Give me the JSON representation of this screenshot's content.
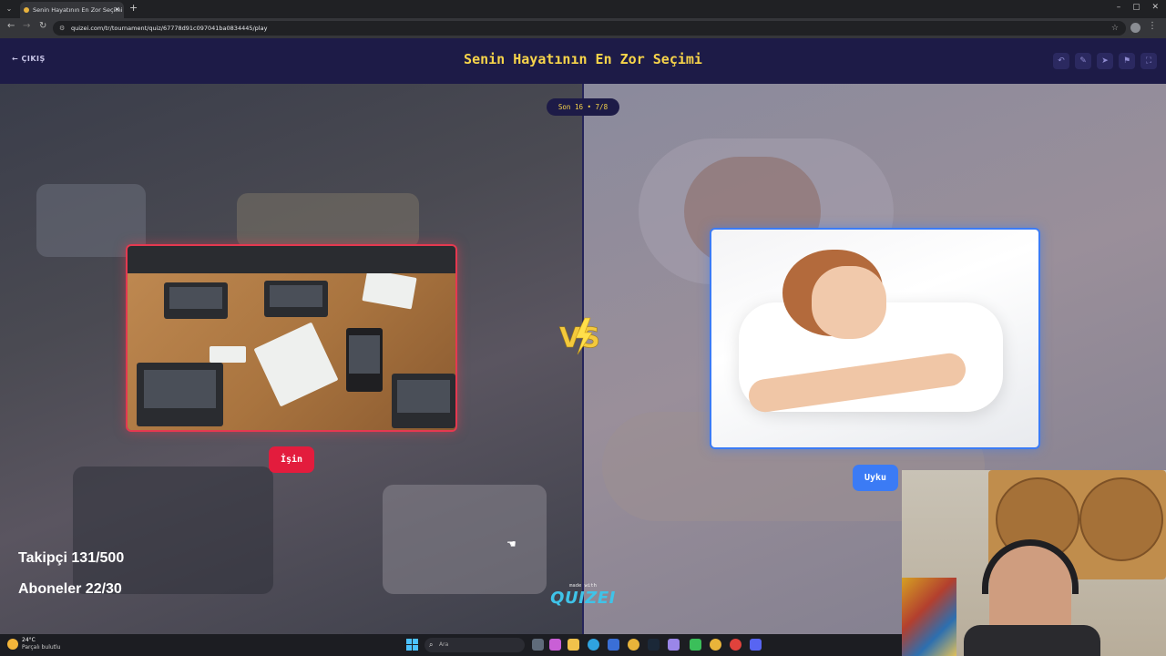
{
  "browser": {
    "tab_title": "Senin Hayatının En Zor Seçimi -",
    "url": "quizei.com/tr/tournament/quiz/67778d91c097041ba0834445/play"
  },
  "header": {
    "exit_label": "ÇIKIŞ",
    "title": "Senin Hayatının En Zor Seçimi"
  },
  "round": {
    "label": "Son 16 • 7/8"
  },
  "choices": {
    "left_label": "İşin",
    "right_label": "Uyku"
  },
  "stats": {
    "followers": "Takipçi 131/500",
    "subscribers": "Aboneler 22/30"
  },
  "branding": {
    "made_with": "made with",
    "logo": "QUIZEI"
  },
  "taskbar": {
    "temperature": "24°C",
    "weather": "Parçalı bulutlu",
    "search_placeholder": "Ara"
  },
  "colors": {
    "header_bg": "#1d1b47",
    "title": "#f7d44a",
    "left_accent": "#e31c3d",
    "right_accent": "#3b7bf5"
  }
}
